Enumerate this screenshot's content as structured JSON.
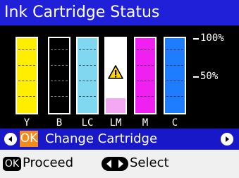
{
  "title": "Ink Cartridge Status",
  "colors": {
    "title_bar": "#2020d8",
    "action_bar": "#1818c8",
    "ok_highlight": "#f48a1c",
    "yellow": "#ffee00",
    "black": "#000000",
    "light_cyan": "#80d8f0",
    "light_magenta": "#f4a8f4",
    "magenta": "#f020f0",
    "cyan": "#1e7cff"
  },
  "cartridges": [
    {
      "label": "Y",
      "color": "#ffee00",
      "level": 1.0,
      "warning": false
    },
    {
      "label": "B",
      "color": "#000000",
      "level": 1.0,
      "warning": false
    },
    {
      "label": "LC",
      "color": "#80d8f0",
      "level": 1.0,
      "warning": false
    },
    {
      "label": "LM",
      "color": "#f4a8f4",
      "level": 0.2,
      "warning": true,
      "warning_icon": "warning-triangle-icon"
    },
    {
      "label": "M",
      "color": "#f020f0",
      "level": 1.0,
      "warning": false
    },
    {
      "label": "C",
      "color": "#1e7cff",
      "level": 1.0,
      "warning": false
    }
  ],
  "scale": {
    "top_label": "100%",
    "mid_label": "50%"
  },
  "action": {
    "left_icon": "left-arrow-icon",
    "ok_label": "OK",
    "text": "Change Cartridge",
    "right_icon": "right-arrow-icon"
  },
  "help": {
    "ok_label": "OK",
    "proceed_text": "Proceed",
    "dpad_icon": "left-right-dpad-icon",
    "select_text": "Select"
  }
}
